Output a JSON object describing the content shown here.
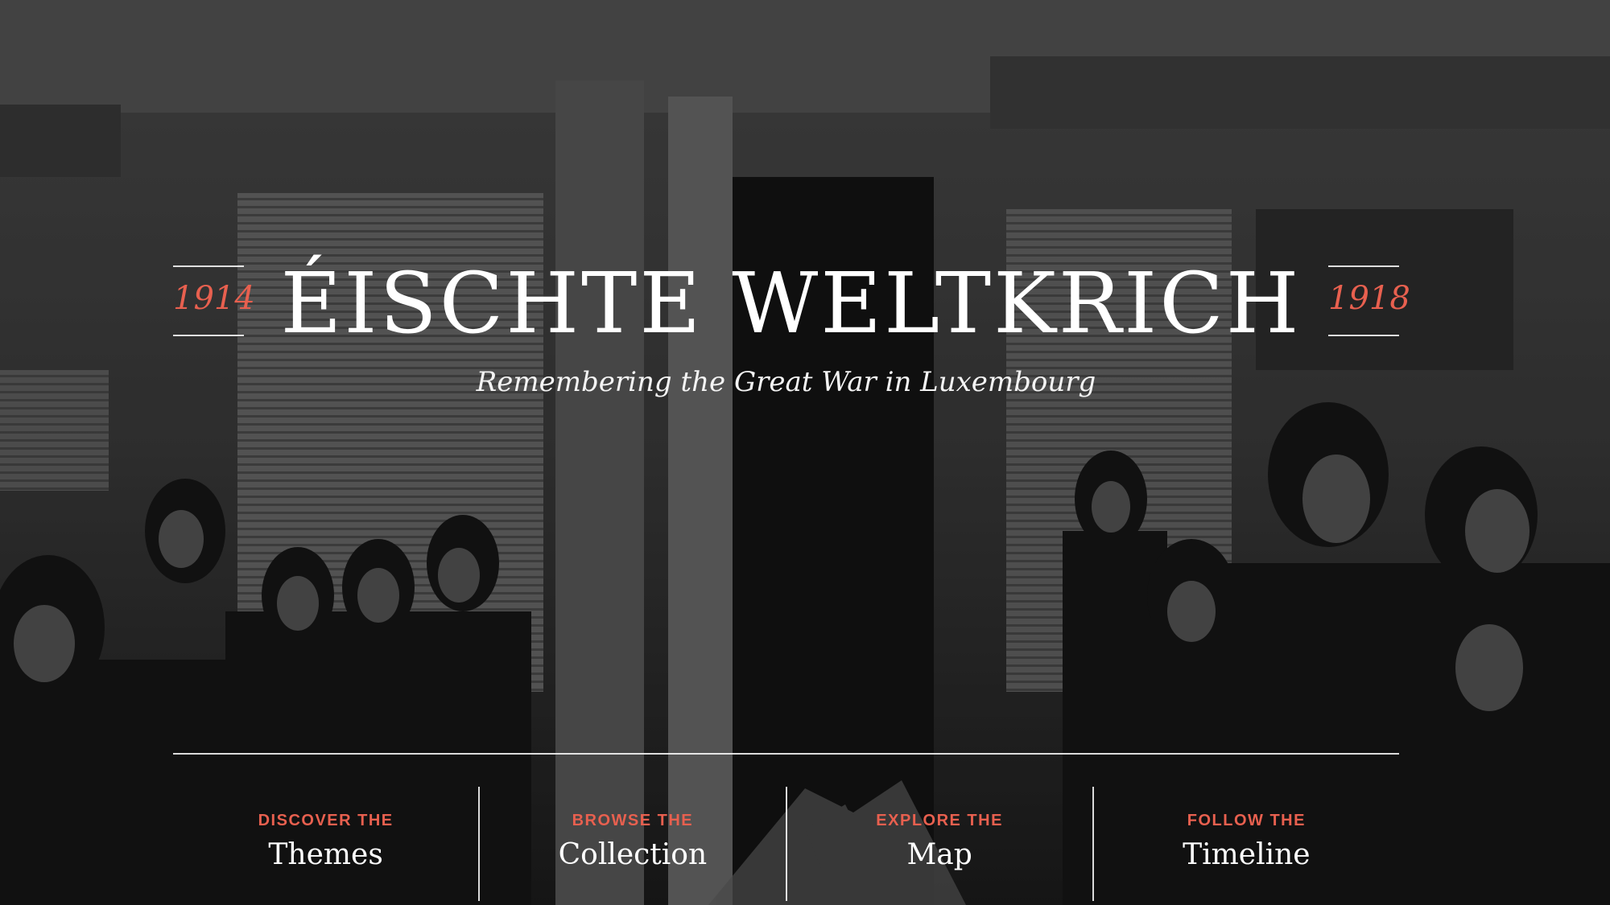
{
  "colors": {
    "accent": "#e8604f",
    "text": "#ffffff"
  },
  "background": {
    "description_icon": "sepia-war-photo"
  },
  "hero": {
    "year_start": "1914",
    "title": "ÉISCHTE WELTKRICH",
    "year_end": "1918",
    "subtitle": "Remembering the Great War in Luxembourg"
  },
  "nav": {
    "items": [
      {
        "kicker": "DISCOVER THE",
        "label": "Themes"
      },
      {
        "kicker": "BROWSE THE",
        "label": "Collection"
      },
      {
        "kicker": "EXPLORE THE",
        "label": "Map"
      },
      {
        "kicker": "FOLLOW THE",
        "label": "Timeline"
      }
    ]
  }
}
